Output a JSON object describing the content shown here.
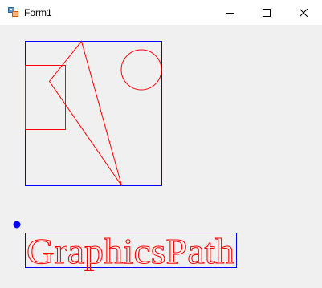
{
  "window": {
    "title": "Form1"
  },
  "caption_buttons": {
    "minimize_icon": "minimize-icon",
    "maximize_icon": "maximize-icon",
    "close_icon": "close-icon"
  },
  "canvas": {
    "graphics_text": "GraphicsPath",
    "colors": {
      "path_stroke": "#ff0000",
      "bounds_stroke": "#0000ff",
      "marker_fill": "#0000ff",
      "background": "#f0f0f0"
    }
  }
}
